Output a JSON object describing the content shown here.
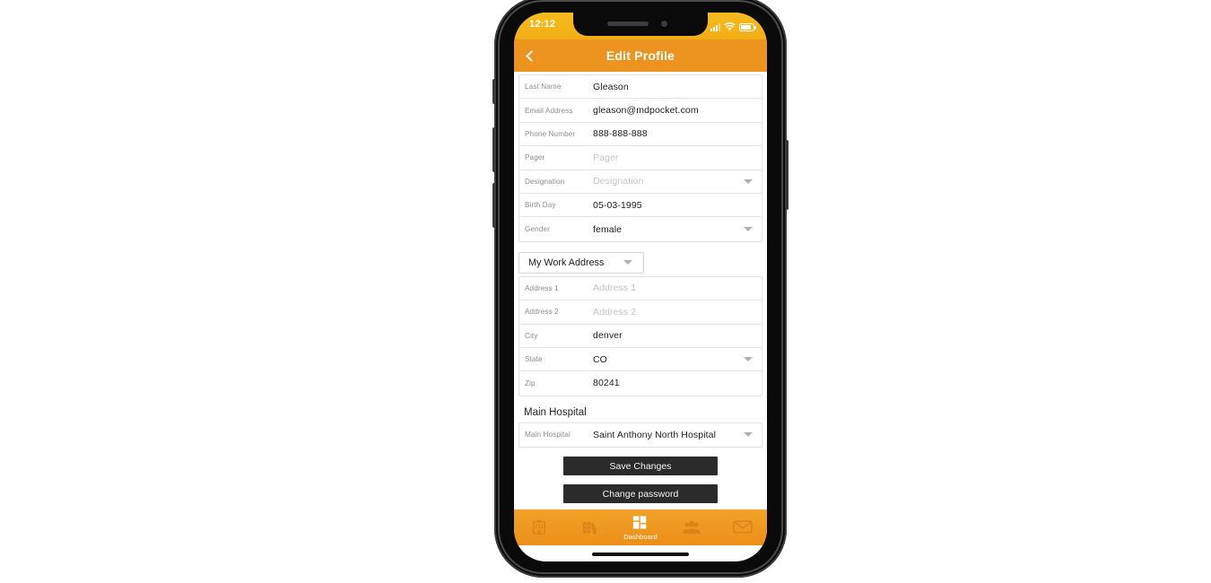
{
  "device": {
    "status_bar": {
      "time": "12:12",
      "signal_icon": "signal-bars-icon",
      "wifi_icon": "wifi-icon",
      "battery_icon": "battery-icon"
    },
    "home_indicator": "home-indicator"
  },
  "appbar": {
    "back_icon": "back-chevron-icon",
    "title": "Edit Profile"
  },
  "colors": {
    "status_bar": "#F5B518",
    "header_orange": "#ED931F",
    "tabbar_orange": "#EF9820",
    "button_dark": "#2B2B2B",
    "label_gray": "#8D8D8D",
    "placeholder_gray": "#C3C3C3"
  },
  "profile_fields": [
    {
      "label": "Last Name",
      "value": "Gleason",
      "is_placeholder": false,
      "has_caret": false
    },
    {
      "label": "Email Address",
      "value": "gleason@mdpocket.com",
      "is_placeholder": false,
      "has_caret": false
    },
    {
      "label": "Phone Number",
      "value": "888-888-888",
      "is_placeholder": false,
      "has_caret": false
    },
    {
      "label": "Pager",
      "value": "Pager",
      "is_placeholder": true,
      "has_caret": false
    },
    {
      "label": "Designation",
      "value": "Designation",
      "is_placeholder": true,
      "has_caret": true
    },
    {
      "label": "Birth Day",
      "value": "05-03-1995",
      "is_placeholder": false,
      "has_caret": false
    },
    {
      "label": "Gender",
      "value": "female",
      "is_placeholder": false,
      "has_caret": true
    }
  ],
  "address_selector": {
    "selected": "My Work Address",
    "caret_icon": "chevron-down-icon"
  },
  "address_fields": [
    {
      "label": "Address 1",
      "value": "Address 1",
      "is_placeholder": true,
      "has_caret": false
    },
    {
      "label": "Address 2",
      "value": "Address 2",
      "is_placeholder": true,
      "has_caret": false
    },
    {
      "label": "City",
      "value": "denver",
      "is_placeholder": false,
      "has_caret": false
    },
    {
      "label": "State",
      "value": "CO",
      "is_placeholder": false,
      "has_caret": true
    },
    {
      "label": "Zip",
      "value": "80241",
      "is_placeholder": false,
      "has_caret": false
    }
  ],
  "hospital_section": {
    "title": "Main Hospital",
    "field": {
      "label": "Main Hospital",
      "value": "Saint Anthony North Hospital",
      "is_placeholder": false,
      "has_caret": true
    }
  },
  "actions": {
    "save_label": "Save Changes",
    "change_password_label": "Change password"
  },
  "tabbar": {
    "items": [
      {
        "icon": "hospital-building-icon",
        "label": "",
        "active": false
      },
      {
        "icon": "books-icon",
        "label": "",
        "active": false
      },
      {
        "icon": "dashboard-grid-icon",
        "label": "Dashboard",
        "active": true
      },
      {
        "icon": "people-group-icon",
        "label": "",
        "active": false
      },
      {
        "icon": "envelope-mail-icon",
        "label": "",
        "active": false
      }
    ]
  }
}
